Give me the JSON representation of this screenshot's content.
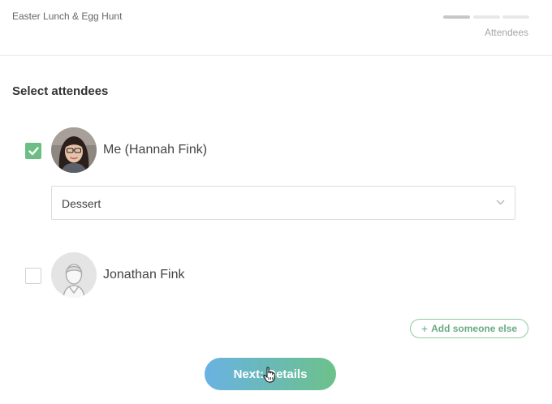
{
  "header": {
    "event_title": "Easter Lunch & Egg Hunt",
    "step_label": "Attendees",
    "progress": {
      "total_steps": 3,
      "current_step": 1
    }
  },
  "section_title": "Select attendees",
  "attendees": [
    {
      "name": "Me (Hannah Fink)",
      "checked": true,
      "has_photo": true,
      "dish_select": {
        "value": "Dessert"
      }
    },
    {
      "name": "Jonathan Fink",
      "checked": false,
      "has_photo": false
    }
  ],
  "add_someone_label": "Add someone else",
  "next_button_label": "Next: Details",
  "colors": {
    "accent_green": "#6cbe85",
    "button_gradient_start": "#69b2e3",
    "button_gradient_end": "#6cc18a"
  },
  "icons": {
    "checkbox_checked": "check-icon",
    "select_arrow": "chevron-down-icon",
    "add": "plus-icon",
    "cursor": "hand-pointer-icon"
  }
}
